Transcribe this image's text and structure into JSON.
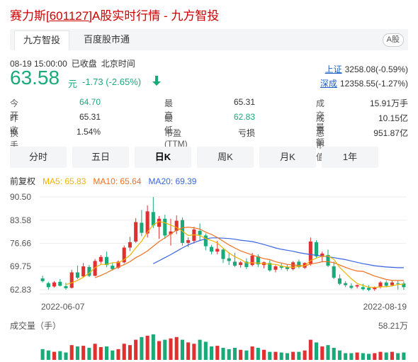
{
  "header": {
    "title_pre": "赛力斯",
    "title_code": "[601127]",
    "title_post": "A股实时行情 - 九方智投"
  },
  "tabs": [
    {
      "label": "九方智投",
      "active": true
    },
    {
      "label": "百度股市通",
      "active": false
    }
  ],
  "market_badge": "A股",
  "quote": {
    "datetime": "08-19 15:00:00",
    "status": "已收盘",
    "timezone": "北京时间",
    "price": "63.58",
    "unit": "元",
    "change": "-1.73 (-2.65%)",
    "direction": "down",
    "color_down": "#1aaa7a",
    "color_up": "#e03030"
  },
  "indices": [
    {
      "name": "上证",
      "value": "3258.08(-0.59%)"
    },
    {
      "name": "深成",
      "value": "12358.55(-1.27%)"
    }
  ],
  "stats": {
    "open_label": "今　开",
    "open": "64.70",
    "high_label": "最　高",
    "high": "65.31",
    "volume_label": "成交量",
    "volume": "15.91万手",
    "prev_label": "昨　收",
    "prev": "65.31",
    "low_label": "最　低",
    "low": "62.83",
    "amount_label": "成交额",
    "amount": "10.15亿",
    "turnover_label": "换手率",
    "turnover": "1.54%",
    "pe_label": "市盈(TTM)",
    "pe": "亏损",
    "mktcap_label": "总市值",
    "mktcap": "951.87亿"
  },
  "periods": [
    {
      "label": "分时",
      "selected": false
    },
    {
      "label": "五日",
      "selected": false
    },
    {
      "label": "日K",
      "selected": true
    },
    {
      "label": "周K",
      "selected": false
    },
    {
      "label": "月K",
      "selected": false
    },
    {
      "label": "1年",
      "selected": false
    }
  ],
  "ma_legend": {
    "adjust": "前复权",
    "ma5": "MA5: 65.83",
    "ma10": "MA10: 65.64",
    "ma20": "MA20: 69.39",
    "ma5_color": "#f0b400",
    "ma10_color": "#f07020",
    "ma20_color": "#3a66e0"
  },
  "chart_data": {
    "type": "candlestick",
    "y_ticks": [
      "90.50",
      "83.58",
      "76.66",
      "69.75",
      "62.83"
    ],
    "ylim": [
      62.83,
      90.5
    ],
    "x_labels": [
      "2022-06-07",
      "2022-08-19"
    ],
    "candles": [
      [
        66.2,
        67.0,
        65.4,
        65.0
      ],
      [
        64.8,
        65.2,
        63.6,
        62.9
      ],
      [
        63.8,
        65.4,
        65.0,
        63.5
      ],
      [
        65.2,
        66.0,
        64.0,
        63.8
      ],
      [
        63.9,
        64.9,
        63.3,
        62.8
      ],
      [
        63.4,
        68.8,
        68.0,
        63.2
      ],
      [
        68.0,
        70.0,
        66.4,
        66.0
      ],
      [
        66.8,
        70.8,
        69.8,
        66.4
      ],
      [
        69.6,
        70.2,
        67.0,
        66.6
      ],
      [
        67.0,
        72.0,
        71.4,
        66.8
      ],
      [
        71.2,
        73.2,
        72.6,
        70.6
      ],
      [
        72.6,
        74.2,
        70.2,
        69.6
      ],
      [
        70.0,
        70.8,
        69.0,
        68.6
      ],
      [
        69.4,
        71.6,
        71.2,
        69.0
      ],
      [
        71.0,
        76.0,
        75.4,
        70.6
      ],
      [
        75.4,
        78.6,
        77.0,
        74.4
      ],
      [
        77.2,
        84.2,
        83.0,
        76.8
      ],
      [
        82.8,
        86.6,
        79.8,
        78.8
      ],
      [
        79.6,
        88.0,
        86.2,
        78.4
      ],
      [
        86.0,
        90.5,
        82.0,
        81.2
      ],
      [
        81.6,
        84.8,
        84.0,
        78.0
      ],
      [
        84.0,
        85.2,
        79.0,
        78.0
      ],
      [
        79.4,
        84.0,
        80.2,
        76.0
      ],
      [
        80.4,
        85.0,
        83.4,
        79.4
      ],
      [
        83.6,
        84.4,
        76.8,
        76.0
      ],
      [
        76.8,
        78.4,
        77.6,
        75.6
      ],
      [
        77.4,
        81.6,
        80.8,
        76.6
      ],
      [
        80.4,
        82.6,
        79.2,
        77.6
      ],
      [
        79.0,
        79.6,
        75.8,
        74.6
      ],
      [
        75.6,
        76.2,
        74.2,
        73.4
      ],
      [
        74.2,
        77.4,
        75.0,
        73.4
      ],
      [
        74.8,
        75.2,
        72.0,
        70.8
      ],
      [
        72.2,
        74.0,
        71.4,
        70.2
      ],
      [
        71.2,
        73.8,
        70.0,
        69.6
      ],
      [
        70.2,
        71.4,
        71.0,
        69.4
      ],
      [
        71.2,
        72.2,
        69.6,
        69.0
      ],
      [
        70.2,
        73.8,
        73.0,
        69.8
      ],
      [
        72.8,
        73.4,
        70.4,
        69.6
      ],
      [
        70.2,
        71.2,
        71.0,
        69.2
      ],
      [
        70.8,
        71.6,
        68.6,
        68.2
      ],
      [
        68.8,
        70.2,
        69.8,
        68.0
      ],
      [
        69.8,
        70.6,
        69.4,
        68.8
      ],
      [
        69.6,
        70.4,
        69.0,
        68.4
      ],
      [
        69.0,
        71.4,
        71.0,
        68.6
      ],
      [
        71.2,
        71.8,
        69.6,
        69.2
      ],
      [
        69.4,
        71.0,
        70.8,
        69.0
      ],
      [
        70.6,
        78.4,
        77.2,
        70.0
      ],
      [
        77.0,
        77.6,
        72.8,
        72.4
      ],
      [
        72.6,
        74.2,
        73.6,
        71.0
      ],
      [
        73.2,
        74.8,
        70.0,
        69.6
      ],
      [
        69.8,
        71.2,
        66.4,
        66.0
      ],
      [
        66.2,
        67.4,
        64.6,
        64.2
      ],
      [
        64.8,
        65.4,
        64.2,
        63.6
      ],
      [
        64.0,
        64.8,
        63.4,
        63.0
      ],
      [
        63.8,
        64.4,
        64.2,
        63.2
      ],
      [
        63.6,
        64.6,
        63.0,
        62.6
      ],
      [
        63.4,
        64.2,
        62.8,
        62.4
      ],
      [
        63.0,
        63.8,
        63.6,
        62.5
      ],
      [
        63.6,
        65.4,
        65.0,
        63.2
      ],
      [
        65.0,
        65.6,
        64.0,
        63.6
      ],
      [
        64.2,
        65.6,
        65.0,
        63.8
      ],
      [
        64.8,
        65.5,
        64.6,
        62.9
      ],
      [
        64.7,
        65.3,
        63.6,
        62.8
      ]
    ],
    "ma5": [
      null,
      null,
      null,
      null,
      64.4,
      64.9,
      65.6,
      66.6,
      67.8,
      69.4,
      70.4,
      70.4,
      70.9,
      70.9,
      71.8,
      73.1,
      75.3,
      77.3,
      80.0,
      82.2,
      83.2,
      82.8,
      82.1,
      81.4,
      80.3,
      79.0,
      79.2,
      79.0,
      78.1,
      77.5,
      76.8,
      75.2,
      73.8,
      72.7,
      71.9,
      70.8,
      70.9,
      70.8,
      70.6,
      70.5,
      70.4,
      69.9,
      69.6,
      69.5,
      69.8,
      70.0,
      71.5,
      72.3,
      72.8,
      72.9,
      71.9,
      69.5,
      67.8,
      66.1,
      64.7,
      64.1,
      63.6,
      63.5,
      63.7,
      63.7,
      64.0,
      64.4,
      64.5
    ],
    "ma10": [
      null,
      null,
      null,
      null,
      null,
      null,
      null,
      null,
      null,
      66.4,
      67.1,
      67.9,
      68.8,
      69.6,
      70.3,
      71.2,
      72.4,
      73.3,
      74.4,
      75.8,
      77.2,
      78.3,
      79.5,
      80.6,
      81.3,
      81.5,
      81.3,
      80.9,
      80.0,
      79.3,
      78.4,
      77.3,
      76.2,
      75.3,
      74.4,
      73.8,
      73.2,
      72.6,
      72.1,
      71.8,
      71.2,
      70.8,
      70.4,
      70.2,
      70.1,
      69.9,
      70.5,
      70.8,
      71.2,
      71.2,
      70.9,
      70.2,
      69.5,
      68.9,
      68.4,
      68.3,
      67.6,
      66.9,
      66.4,
      65.9,
      65.6,
      65.6,
      65.6
    ],
    "ma20": [
      null,
      null,
      null,
      null,
      null,
      null,
      null,
      null,
      null,
      null,
      null,
      null,
      null,
      null,
      null,
      null,
      null,
      null,
      null,
      70.6,
      71.5,
      72.4,
      73.3,
      74.3,
      75.3,
      76.2,
      76.9,
      77.5,
      78.0,
      78.3,
      78.3,
      78.2,
      78.1,
      77.9,
      77.6,
      77.4,
      77.2,
      76.8,
      76.3,
      75.8,
      75.3,
      74.9,
      74.6,
      74.3,
      73.9,
      73.6,
      73.3,
      73.1,
      72.9,
      72.7,
      72.4,
      72.1,
      71.8,
      71.4,
      71.0,
      70.6,
      70.3,
      70.0,
      69.8,
      69.6,
      69.5,
      69.4,
      69.4
    ]
  },
  "volume": {
    "label": "成交量（手）",
    "max_label": "58.21万",
    "values": [
      16,
      14,
      12,
      13,
      11,
      22,
      20,
      21,
      18,
      24,
      19,
      20,
      14,
      16,
      24,
      22,
      30,
      34,
      36,
      38,
      28,
      30,
      32,
      34,
      30,
      26,
      24,
      30,
      27,
      20,
      21,
      18,
      16,
      18,
      15,
      14,
      20,
      18,
      15,
      12,
      12,
      11,
      10,
      12,
      12,
      14,
      30,
      26,
      20,
      22,
      18,
      14,
      10,
      10,
      11,
      10,
      9,
      10,
      12,
      11,
      12,
      10,
      11
    ]
  }
}
